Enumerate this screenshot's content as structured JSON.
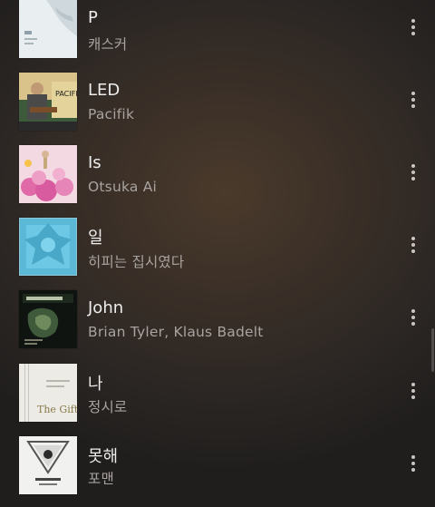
{
  "songs": [
    {
      "title": "P",
      "artist": "캐스커",
      "art_icon": "album-art-cover"
    },
    {
      "title": "LED",
      "artist": "Pacifik",
      "art_icon": "album-art-cover"
    },
    {
      "title": "Is",
      "artist": "Otsuka Ai",
      "art_icon": "album-art-cover"
    },
    {
      "title": "일",
      "artist": "히피는 집시였다",
      "art_icon": "album-art-cover"
    },
    {
      "title": "John",
      "artist": "Brian Tyler, Klaus Badelt",
      "art_icon": "album-art-cover"
    },
    {
      "title": "나",
      "artist": "정시로",
      "art_icon": "album-art-cover"
    },
    {
      "title": "못해",
      "artist": "포맨",
      "art_icon": "album-art-cover"
    }
  ],
  "more_icon": "more-vertical-icon",
  "album_text": {
    "pacifik": "PACIFIK",
    "gift": "The Gift"
  }
}
